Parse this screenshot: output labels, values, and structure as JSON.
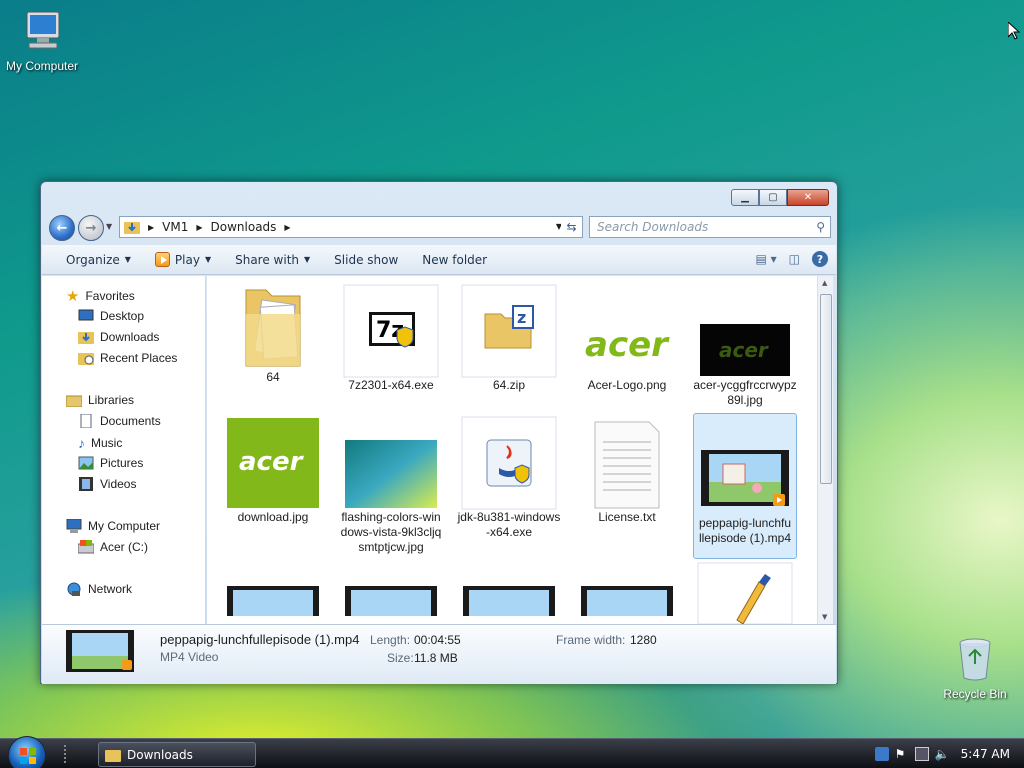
{
  "desktop": {
    "my_computer": "My Computer",
    "recycle_bin": "Recycle Bin"
  },
  "window": {
    "address": {
      "root": "VM1",
      "folder": "Downloads"
    },
    "search_placeholder": "Search Downloads",
    "toolbar": {
      "organize": "Organize",
      "play": "Play",
      "share_with": "Share with",
      "slide_show": "Slide show",
      "new_folder": "New folder"
    },
    "nav": {
      "favorites": "Favorites",
      "desktop": "Desktop",
      "downloads": "Downloads",
      "recent_places": "Recent Places",
      "libraries": "Libraries",
      "documents": "Documents",
      "music": "Music",
      "pictures": "Pictures",
      "videos": "Videos",
      "my_computer": "My Computer",
      "drive": "Acer (C:)",
      "network": "Network"
    },
    "files": [
      {
        "name": "64",
        "icon": "folder-icon"
      },
      {
        "name": "7z2301-x64.exe",
        "icon": "7zip-installer-icon"
      },
      {
        "name": "64.zip",
        "icon": "zip-folder-icon"
      },
      {
        "name": "Acer-Logo.png",
        "icon": "image-thumbnail"
      },
      {
        "name": "acer-ycggfrccrwypz89l.jpg",
        "icon": "image-thumbnail"
      },
      {
        "name": "download.jpg",
        "icon": "image-thumbnail"
      },
      {
        "name": "flashing-colors-windows-vista-9kl3cljqsmtptjcw.jpg",
        "icon": "image-thumbnail"
      },
      {
        "name": "jdk-8u381-windows-x64.exe",
        "icon": "java-installer-icon"
      },
      {
        "name": "License.txt",
        "icon": "text-file-icon"
      },
      {
        "name": "peppapig-lunchfullepisode (1).mp4",
        "icon": "video-thumbnail"
      }
    ],
    "details": {
      "name": "peppapig-lunchfullepisode (1).mp4",
      "type": "MP4 Video",
      "length_label": "Length:",
      "length": "00:04:55",
      "size_label": "Size:",
      "size": "11.8 MB",
      "frame_label": "Frame width:",
      "frame_width": "1280"
    }
  },
  "taskbar": {
    "window_button": "Downloads",
    "clock": "5:47 AM"
  },
  "colors": {
    "acer_green": "#83b81a",
    "selection": "#d9ecfc",
    "taskbar": "#1e2128"
  }
}
